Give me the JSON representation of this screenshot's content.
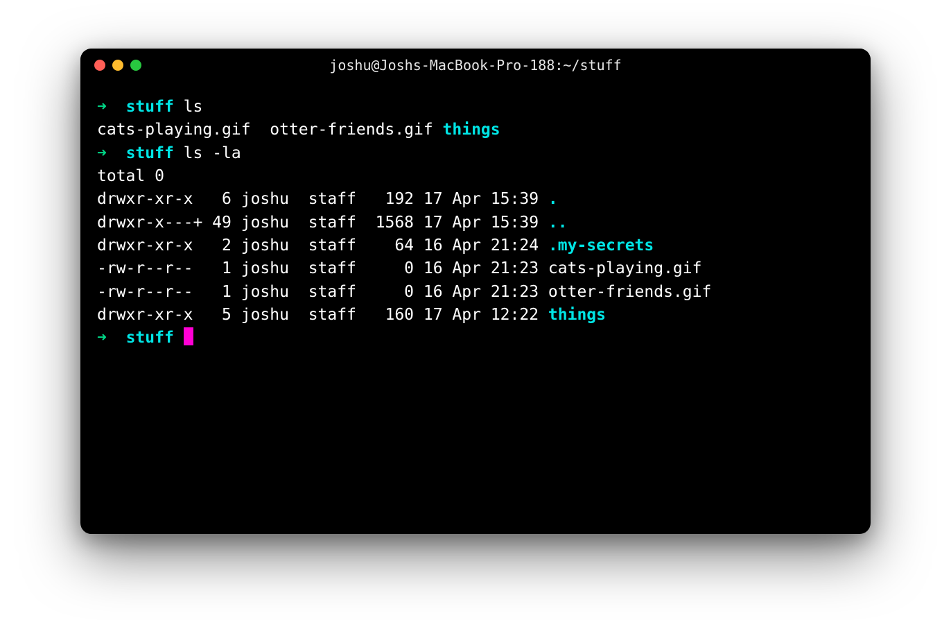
{
  "window": {
    "title": "joshu@Joshs-MacBook-Pro-188:~/stuff"
  },
  "prompt": {
    "arrow": "➜",
    "cwd": "stuff"
  },
  "commands": {
    "ls": "ls",
    "lsla": "ls -la"
  },
  "ls_output": {
    "file1": "cats-playing.gif",
    "file2": "otter-friends.gif",
    "dir1": "things"
  },
  "lsla_output": {
    "total": "total 0",
    "rows": [
      {
        "perms": "drwxr-xr-x  ",
        "links": " 6",
        "owner": "joshu",
        "group": "staff",
        "size": " 192",
        "date": "17 Apr 15:39",
        "name": ".",
        "is_dir": true
      },
      {
        "perms": "drwxr-x---+ ",
        "links": "49",
        "owner": "joshu",
        "group": "staff",
        "size": "1568",
        "date": "17 Apr 15:39",
        "name": "..",
        "is_dir": true
      },
      {
        "perms": "drwxr-xr-x  ",
        "links": " 2",
        "owner": "joshu",
        "group": "staff",
        "size": "  64",
        "date": "16 Apr 21:24",
        "name": ".my-secrets",
        "is_dir": true
      },
      {
        "perms": "-rw-r--r--  ",
        "links": " 1",
        "owner": "joshu",
        "group": "staff",
        "size": "   0",
        "date": "16 Apr 21:23",
        "name": "cats-playing.gif",
        "is_dir": false
      },
      {
        "perms": "-rw-r--r--  ",
        "links": " 1",
        "owner": "joshu",
        "group": "staff",
        "size": "   0",
        "date": "16 Apr 21:23",
        "name": "otter-friends.gif",
        "is_dir": false
      },
      {
        "perms": "drwxr-xr-x  ",
        "links": " 5",
        "owner": "joshu",
        "group": "staff",
        "size": " 160",
        "date": "17 Apr 12:22",
        "name": "things",
        "is_dir": true
      }
    ]
  }
}
